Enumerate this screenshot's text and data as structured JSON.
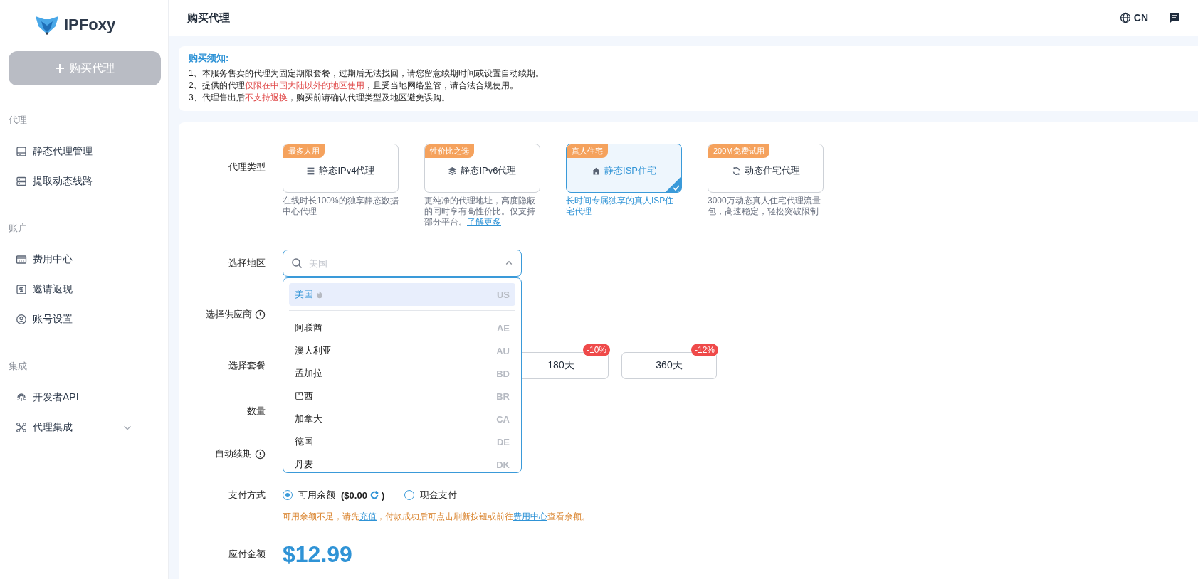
{
  "logo": {
    "text": "IPFoxy"
  },
  "sidebar": {
    "buy_button": "购买代理",
    "sections": [
      {
        "title": "代理",
        "items": [
          {
            "label": "静态代理管理"
          },
          {
            "label": "提取动态线路"
          }
        ]
      },
      {
        "title": "账户",
        "items": [
          {
            "label": "费用中心"
          },
          {
            "label": "邀请返现"
          },
          {
            "label": "账号设置"
          }
        ]
      },
      {
        "title": "集成",
        "items": [
          {
            "label": "开发者API"
          },
          {
            "label": "代理集成",
            "expanded": false
          }
        ]
      }
    ]
  },
  "header": {
    "title": "购买代理",
    "language": "CN"
  },
  "notice": {
    "title": "购买须知:",
    "lines": [
      [
        {
          "text": "1、本服务售卖的代理为固定期限套餐，过期后无法找回，请您留意续期时间或设置自动续期。",
          "highlight": false
        }
      ],
      [
        {
          "text": "2、提供的代理",
          "highlight": false
        },
        {
          "text": "仅限在中国大陆以外的地区使用",
          "highlight": true
        },
        {
          "text": "，且受当地网络监管，请合法合规使用。",
          "highlight": false
        }
      ],
      [
        {
          "text": "3、代理售出后",
          "highlight": false
        },
        {
          "text": "不支持退换",
          "highlight": true
        },
        {
          "text": "，购买前请确认代理类型及地区避免误购。",
          "highlight": false
        }
      ]
    ]
  },
  "form": {
    "proxy_type": {
      "label": "代理类型",
      "options": [
        {
          "badge": "最多人用",
          "name": "静态IPv4代理",
          "description": "在线时长100%的独享静态数据中心代理",
          "selected": false
        },
        {
          "badge": "性价比之选",
          "name": "静态IPv6代理",
          "description": "更纯净的代理地址，高度隐蔽的同时享有高性价比。仅支持部分平台。",
          "link": "了解更多",
          "selected": false
        },
        {
          "badge": "真人住宅",
          "name": "静态ISP住宅",
          "description": "长时间专属独享的真人ISP住宅代理",
          "selected": true
        },
        {
          "badge": "200M免费试用",
          "name": "动态住宅代理",
          "description": "3000万动态真人住宅代理流量包，高速稳定，轻松突破限制",
          "selected": false
        }
      ]
    },
    "region": {
      "label": "选择地区",
      "placeholder": "美国",
      "expanded": true,
      "options": [
        {
          "name": "美国",
          "code": "US",
          "hot": true,
          "selected": true
        },
        {
          "name": "阿联酋",
          "code": "AE",
          "hot": false,
          "selected": false
        },
        {
          "name": "澳大利亚",
          "code": "AU",
          "hot": false,
          "selected": false
        },
        {
          "name": "孟加拉",
          "code": "BD",
          "hot": false,
          "selected": false
        },
        {
          "name": "巴西",
          "code": "BR",
          "hot": false,
          "selected": false
        },
        {
          "name": "加拿大",
          "code": "CA",
          "hot": false,
          "selected": false
        },
        {
          "name": "德国",
          "code": "DE",
          "hot": false,
          "selected": false
        },
        {
          "name": "丹麦",
          "code": "DK",
          "hot": false,
          "selected": false
        }
      ]
    },
    "supplier": {
      "label": "选择供应商",
      "info": true
    },
    "plan": {
      "label": "选择套餐",
      "options": [
        {
          "label": "180天",
          "discount": "-10%"
        },
        {
          "label": "360天",
          "discount": "-12%"
        }
      ]
    },
    "quantity": {
      "label": "数量"
    },
    "auto_renew": {
      "label": "自动续期",
      "info": true
    },
    "payment": {
      "label": "支付方式",
      "options": [
        {
          "kind": "balance",
          "label": "可用余额",
          "balance": "($0.00",
          "balance_end": ")",
          "selected": true
        },
        {
          "kind": "plain",
          "label": "现金支付",
          "selected": false
        }
      ],
      "note": [
        {
          "text": "可用余额不足，请先",
          "link": false
        },
        {
          "text": "充值",
          "link": true
        },
        {
          "text": "，付款成功后可点击刷新按钮或前往",
          "link": false
        },
        {
          "text": "费用中心",
          "link": true
        },
        {
          "text": "查看余额。",
          "link": false
        }
      ]
    },
    "amount": {
      "label": "应付金额",
      "value": "$12.99"
    }
  }
}
